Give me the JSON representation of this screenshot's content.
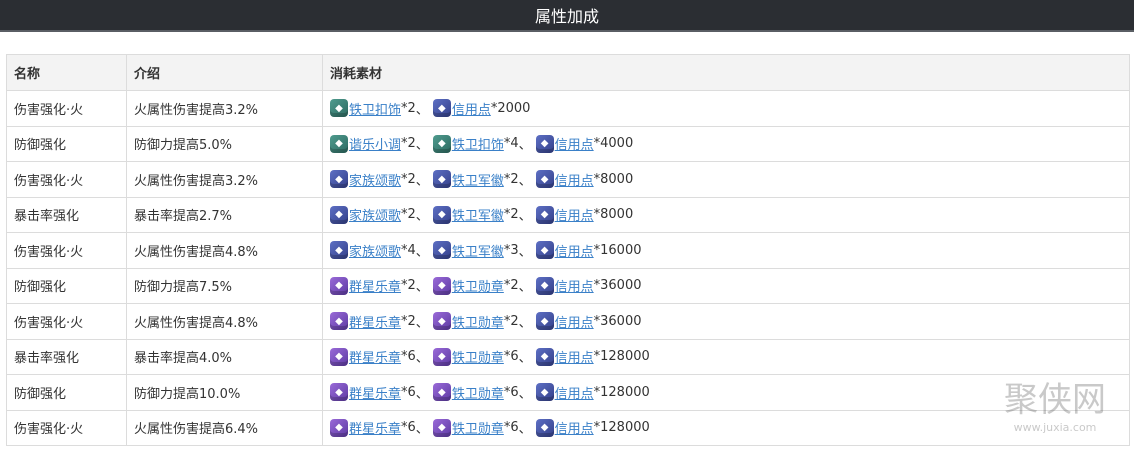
{
  "page": {
    "title": "属性加成"
  },
  "table": {
    "headers": [
      "名称",
      "介绍",
      "消耗素材"
    ],
    "rows": [
      {
        "name": "伤害强化·火",
        "desc": "火属性伤害提高3.2%",
        "materials": [
          {
            "label": "铁卫扣饰",
            "qty": "*2",
            "icon": "green"
          },
          {
            "label": "信用点",
            "qty": "*2000",
            "icon": "blue"
          }
        ]
      },
      {
        "name": "防御强化",
        "desc": "防御力提高5.0%",
        "materials": [
          {
            "label": "谐乐小调",
            "qty": "*2",
            "icon": "green"
          },
          {
            "label": "铁卫扣饰",
            "qty": "*4",
            "icon": "green"
          },
          {
            "label": "信用点",
            "qty": "*4000",
            "icon": "blue"
          }
        ]
      },
      {
        "name": "伤害强化·火",
        "desc": "火属性伤害提高3.2%",
        "materials": [
          {
            "label": "家族颂歌",
            "qty": "*2",
            "icon": "blue"
          },
          {
            "label": "铁卫军徽",
            "qty": "*2",
            "icon": "blue"
          },
          {
            "label": "信用点",
            "qty": "*8000",
            "icon": "blue"
          }
        ]
      },
      {
        "name": "暴击率强化",
        "desc": "暴击率提高2.7%",
        "materials": [
          {
            "label": "家族颂歌",
            "qty": "*2",
            "icon": "blue"
          },
          {
            "label": "铁卫军徽",
            "qty": "*2",
            "icon": "blue"
          },
          {
            "label": "信用点",
            "qty": "*8000",
            "icon": "blue"
          }
        ]
      },
      {
        "name": "伤害强化·火",
        "desc": "火属性伤害提高4.8%",
        "materials": [
          {
            "label": "家族颂歌",
            "qty": "*4",
            "icon": "blue"
          },
          {
            "label": "铁卫军徽",
            "qty": "*3",
            "icon": "blue"
          },
          {
            "label": "信用点",
            "qty": "*16000",
            "icon": "blue"
          }
        ]
      },
      {
        "name": "防御强化",
        "desc": "防御力提高7.5%",
        "materials": [
          {
            "label": "群星乐章",
            "qty": "*2",
            "icon": "purple"
          },
          {
            "label": "铁卫勋章",
            "qty": "*2",
            "icon": "purple"
          },
          {
            "label": "信用点",
            "qty": "*36000",
            "icon": "blue"
          }
        ]
      },
      {
        "name": "伤害强化·火",
        "desc": "火属性伤害提高4.8%",
        "materials": [
          {
            "label": "群星乐章",
            "qty": "*2",
            "icon": "purple"
          },
          {
            "label": "铁卫勋章",
            "qty": "*2",
            "icon": "purple"
          },
          {
            "label": "信用点",
            "qty": "*36000",
            "icon": "blue"
          }
        ]
      },
      {
        "name": "暴击率强化",
        "desc": "暴击率提高4.0%",
        "materials": [
          {
            "label": "群星乐章",
            "qty": "*6",
            "icon": "purple"
          },
          {
            "label": "铁卫勋章",
            "qty": "*6",
            "icon": "purple"
          },
          {
            "label": "信用点",
            "qty": "*128000",
            "icon": "blue"
          }
        ]
      },
      {
        "name": "防御强化",
        "desc": "防御力提高10.0%",
        "materials": [
          {
            "label": "群星乐章",
            "qty": "*6",
            "icon": "purple"
          },
          {
            "label": "铁卫勋章",
            "qty": "*6",
            "icon": "purple"
          },
          {
            "label": "信用点",
            "qty": "*128000",
            "icon": "blue"
          }
        ]
      },
      {
        "name": "伤害强化·火",
        "desc": "火属性伤害提高6.4%",
        "materials": [
          {
            "label": "群星乐章",
            "qty": "*6",
            "icon": "purple"
          },
          {
            "label": "铁卫勋章",
            "qty": "*6",
            "icon": "purple"
          },
          {
            "label": "信用点",
            "qty": "*128000",
            "icon": "blue"
          }
        ]
      }
    ],
    "separator": "、"
  },
  "watermark": {
    "text": "聚侠网",
    "url": "www.juxia.com"
  },
  "colors": {
    "header_bg": "#2b2e33",
    "link": "#3a80c8",
    "border": "#dcdcdc"
  }
}
